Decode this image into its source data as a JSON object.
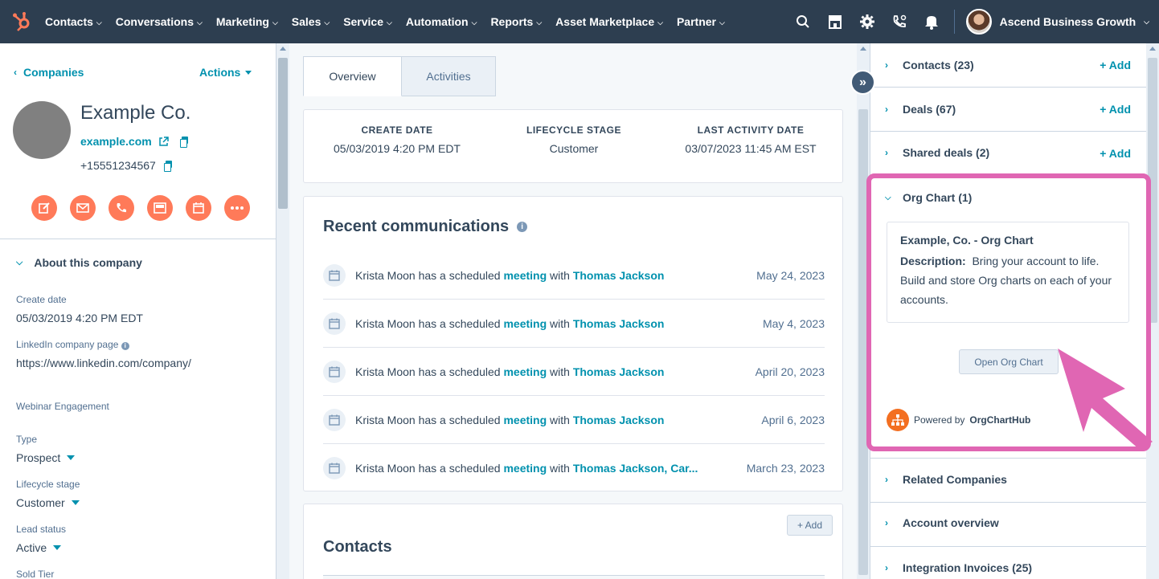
{
  "topnav": {
    "items": [
      {
        "label": "Contacts"
      },
      {
        "label": "Conversations"
      },
      {
        "label": "Marketing"
      },
      {
        "label": "Sales"
      },
      {
        "label": "Service"
      },
      {
        "label": "Automation"
      },
      {
        "label": "Reports"
      },
      {
        "label": "Asset Marketplace"
      },
      {
        "label": "Partner"
      }
    ],
    "icons": [
      "search-icon",
      "marketplace-icon",
      "settings-icon",
      "calling-icon",
      "notifications-icon"
    ],
    "account_name": "Ascend Business Growth"
  },
  "left": {
    "back_label": "Companies",
    "actions_label": "Actions",
    "company_name": "Example Co.",
    "domain": "example.com",
    "phone": "+15551234567",
    "action_icons": [
      "note-icon",
      "email-icon",
      "call-icon",
      "log-icon",
      "meeting-icon",
      "more-icon"
    ],
    "about_title": "About this company",
    "properties": {
      "create_date": {
        "label": "Create date",
        "value": "05/03/2019 4:20 PM EDT"
      },
      "linkedin": {
        "label": "LinkedIn company page",
        "value": "https://www.linkedin.com/company/"
      },
      "webinar": {
        "label": "Webinar Engagement"
      },
      "type": {
        "label": "Type",
        "value": "Prospect"
      },
      "lifecycle": {
        "label": "Lifecycle stage",
        "value": "Customer"
      },
      "lead_status": {
        "label": "Lead status",
        "value": "Active"
      },
      "sold_tier": {
        "label": "Sold Tier"
      }
    }
  },
  "middle": {
    "tabs": [
      {
        "label": "Overview"
      },
      {
        "label": "Activities"
      }
    ],
    "highlights": [
      {
        "label": "CREATE DATE",
        "value": "05/03/2019 4:20 PM EDT"
      },
      {
        "label": "LIFECYCLE STAGE",
        "value": "Customer"
      },
      {
        "label": "LAST ACTIVITY DATE",
        "value": "03/07/2023 11:45 AM EST"
      }
    ],
    "recent_title": "Recent communications",
    "communications": [
      {
        "prefix": "Krista Moon has a scheduled ",
        "link1": "meeting",
        "middle": " with ",
        "link2": "Thomas Jackson",
        "date": "May 24, 2023"
      },
      {
        "prefix": "Krista Moon has a scheduled ",
        "link1": "meeting",
        "middle": " with ",
        "link2": "Thomas Jackson",
        "date": "May 4, 2023"
      },
      {
        "prefix": "Krista Moon has a scheduled ",
        "link1": "meeting",
        "middle": " with ",
        "link2": "Thomas Jackson",
        "date": "April 20, 2023"
      },
      {
        "prefix": "Krista Moon has a scheduled ",
        "link1": "meeting",
        "middle": " with ",
        "link2": "Thomas Jackson",
        "date": "April 6, 2023"
      },
      {
        "prefix": "Krista Moon has a scheduled ",
        "link1": "meeting",
        "middle": " with ",
        "link2": "Thomas Jackson, Car...",
        "date": "March 23, 2023"
      }
    ],
    "contacts_title": "Contacts",
    "contacts_add": "+ Add"
  },
  "right": {
    "sections": [
      {
        "label": "Contacts (23)",
        "add": "+ Add"
      },
      {
        "label": "Deals (67)",
        "add": "+ Add"
      },
      {
        "label": "Shared deals (2)",
        "add": "+ Add"
      }
    ],
    "org": {
      "label": "Org Chart (1)",
      "card_title": "Example, Co. - Org Chart",
      "desc_label": "Description:",
      "desc_text": "Bring your account to life. Build and store Org charts on each of your accounts.",
      "button": "Open Org Chart",
      "powered_prefix": "Powered by",
      "powered_brand": "OrgChartHub"
    },
    "lower_sections": [
      {
        "label": "Related Companies"
      },
      {
        "label": "Account overview"
      },
      {
        "label": "Integration Invoices (25)"
      }
    ]
  },
  "colors": {
    "nav_bg": "#2d3e50",
    "link": "#0091ae",
    "action_orange": "#ff7a59",
    "highlight_pink": "#e066b3",
    "orgcharthub_orange": "#f36f21"
  }
}
